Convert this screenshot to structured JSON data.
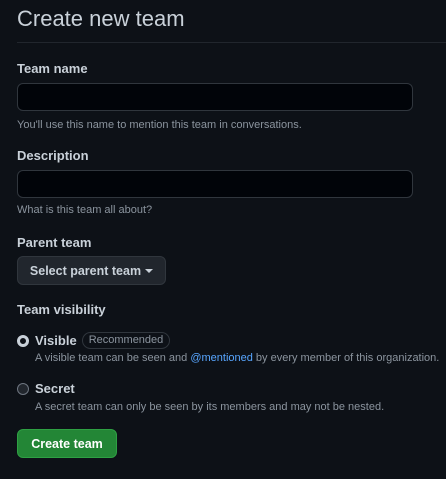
{
  "page": {
    "title": "Create new team"
  },
  "team_name": {
    "label": "Team name",
    "value": "",
    "placeholder": "",
    "hint": "You'll use this name to mention this team in conversations."
  },
  "description": {
    "label": "Description",
    "value": "",
    "placeholder": "",
    "hint": "What is this team all about?"
  },
  "parent_team": {
    "label": "Parent team",
    "button_label": "Select parent team"
  },
  "visibility": {
    "label": "Team visibility",
    "options": [
      {
        "title": "Visible",
        "badge": "Recommended",
        "checked": true,
        "desc_before": "A visible team can be seen and ",
        "desc_mention": "@mentioned",
        "desc_after": " by every member of this organization."
      },
      {
        "title": "Secret",
        "checked": false,
        "desc": "A secret team can only be seen by its members and may not be nested."
      }
    ]
  },
  "actions": {
    "create_label": "Create team"
  },
  "colors": {
    "background": "#0d1117",
    "primary_button": "#238636",
    "link": "#58a6ff"
  }
}
